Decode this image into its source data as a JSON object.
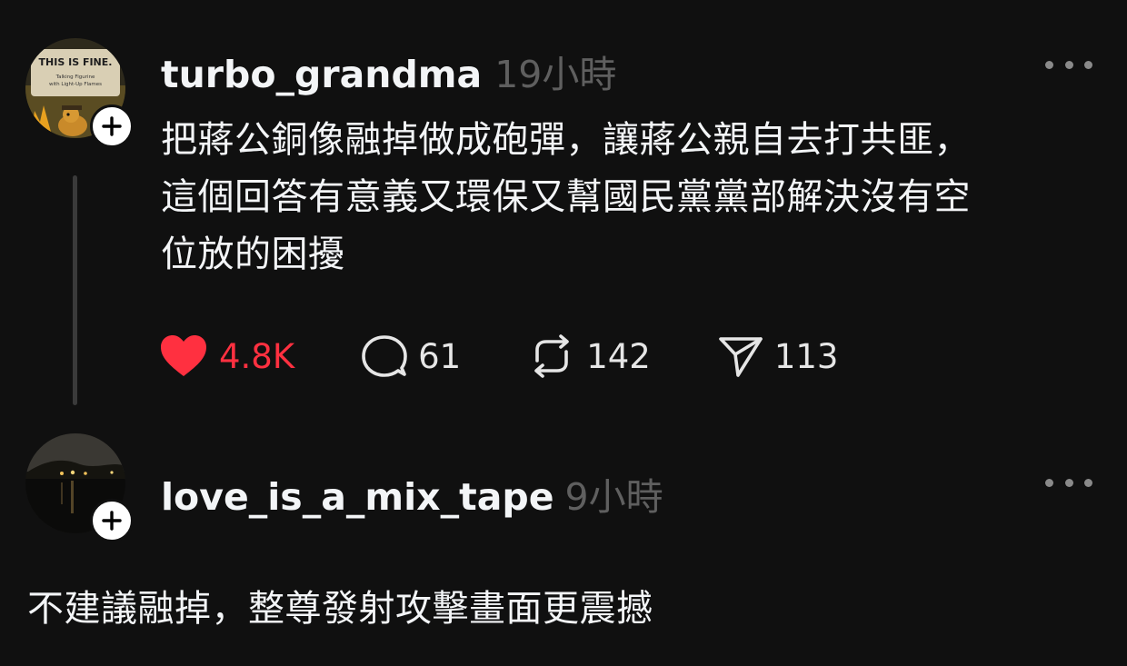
{
  "posts": [
    {
      "username": "turbo_grandma",
      "timestamp": "19小時",
      "text_lines": [
        "把蔣公銅像融掉做成砲彈，讓蔣公親自去打共匪，",
        "這個回答有意義又環保又幫國民黨黨部解決沒有空",
        "位放的困擾"
      ],
      "avatar": {
        "sign_text": "THIS IS FINE.",
        "sub_lines": [
          "Talking Figurine",
          "with Light-Up Flames"
        ]
      },
      "actions": {
        "likes": "4.8K",
        "replies": "61",
        "reposts": "142",
        "shares": "113"
      }
    },
    {
      "username": "love_is_a_mix_tape",
      "timestamp": "9小時",
      "text": "不建議融掉，整尊發射攻擊畫面更震撼"
    }
  ],
  "icons": {
    "follow": "plus-icon",
    "more": "more-horizontal-icon",
    "like": "heart-icon",
    "reply": "comment-icon",
    "repost": "repost-icon",
    "share": "send-icon"
  },
  "colors": {
    "background": "#101010",
    "like_active": "#ff3040",
    "muted": "#5f5f5f"
  }
}
